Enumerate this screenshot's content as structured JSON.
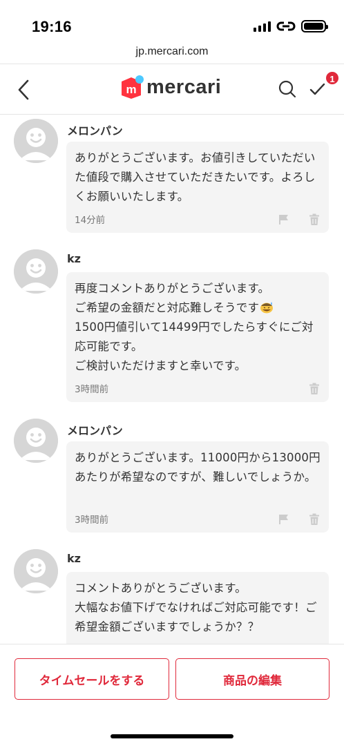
{
  "status_bar": {
    "time": "19:16"
  },
  "browser": {
    "url": "jp.mercari.com"
  },
  "header": {
    "logo_text": "mercari",
    "logo_badge": "m",
    "todo_badge_count": "1",
    "brand_color": "#ff333f",
    "accent_color": "#e0283a",
    "logo_dot_color": "#4dc9ff"
  },
  "comments": [
    {
      "author": "メロンパン",
      "text": "ありがとうございます。お値引きしていただいた値段で購入させていただきたいです。よろしくお願いいたします。",
      "time": "14分前",
      "has_flag": true,
      "has_trash": true
    },
    {
      "author": "kz",
      "text_before_emoji": "再度コメントありがとうございます。\nご希望の金額だと対応難しそうです",
      "emoji": "sweat-smile",
      "text_after_emoji": "\n1500円値引いて14499円でしたらすぐにご対応可能です。\nご検討いただけますと幸いです。",
      "time": "3時間前",
      "has_flag": false,
      "has_trash": true
    },
    {
      "author": "メロンパン",
      "text": "ありがとうございます。11000円から13000円あたりが希望なのですが、難しいでしょうか。",
      "time": "3時間前",
      "has_flag": true,
      "has_trash": true
    },
    {
      "author": "kz",
      "text": "コメントありがとうございます。\n大幅なお値下げでなければご対応可能です！ご希望金額ございますでしょうか？？"
    }
  ],
  "actions": {
    "time_sale_label": "タイムセールをする",
    "edit_item_label": "商品の編集"
  },
  "icons": [
    "back-icon",
    "search-icon",
    "todo-check-icon",
    "flag-icon",
    "trash-icon",
    "avatar-icon",
    "sweat-smile-emoji"
  ]
}
